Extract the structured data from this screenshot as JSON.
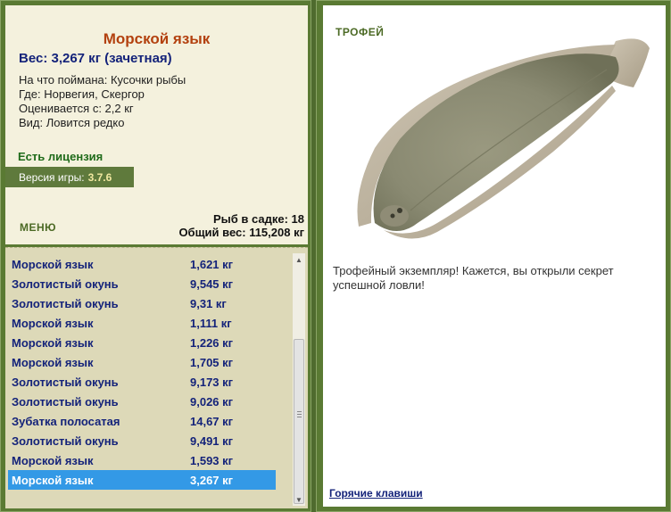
{
  "fish": {
    "title": "Морской язык",
    "weight": "Вес: 3,267 кг (зачетная)",
    "caught_with": "На что поймана: Кусочки рыбы",
    "location": "Где: Норвегия, Скергор",
    "valued_from": "Оценивается с: 2,2 кг",
    "kind": "Вид: Ловится редко"
  },
  "license": "Есть лицензия",
  "version": {
    "label": "Версия игры:",
    "value": "3.7.6"
  },
  "menu_label": "МЕНЮ",
  "stats": {
    "fish_in_net": "Рыб в садке: 18",
    "total_weight": "Общий вес: 115,208 кг"
  },
  "catch_list": [
    {
      "name": "Морской язык",
      "weight": "1,621 кг"
    },
    {
      "name": "Золотистый окунь",
      "weight": "9,545 кг"
    },
    {
      "name": "Золотистый окунь",
      "weight": "9,31 кг"
    },
    {
      "name": "Морской язык",
      "weight": "1,111 кг"
    },
    {
      "name": "Морской язык",
      "weight": "1,226 кг"
    },
    {
      "name": "Морской язык",
      "weight": "1,705 кг"
    },
    {
      "name": "Золотистый окунь",
      "weight": "9,173 кг"
    },
    {
      "name": "Золотистый окунь",
      "weight": "9,026 кг"
    },
    {
      "name": "Зубатка полосатая",
      "weight": "14,67 кг"
    },
    {
      "name": "Золотистый окунь",
      "weight": "9,491 кг"
    },
    {
      "name": "Морской язык",
      "weight": "1,593 кг"
    },
    {
      "name": "Морской язык",
      "weight": "3,267 кг",
      "selected": true
    }
  ],
  "trophy": {
    "label": "ТРОФЕЙ",
    "text": "Трофейный экземпляр! Кажется, вы открыли секрет успешной ловли!"
  },
  "hotkeys_link": "Горячие клавиши",
  "colors": {
    "frame": "#5a7a33",
    "panel_bg": "#f4f1dd",
    "list_bg": "#ddd9b8",
    "title": "#b3410f",
    "text_blue": "#14237a",
    "license": "#1f6b1a",
    "selected_row": "#3399e6"
  },
  "icons": {
    "scroll_up": "arrow-up-icon",
    "scroll_down": "arrow-down-icon"
  }
}
